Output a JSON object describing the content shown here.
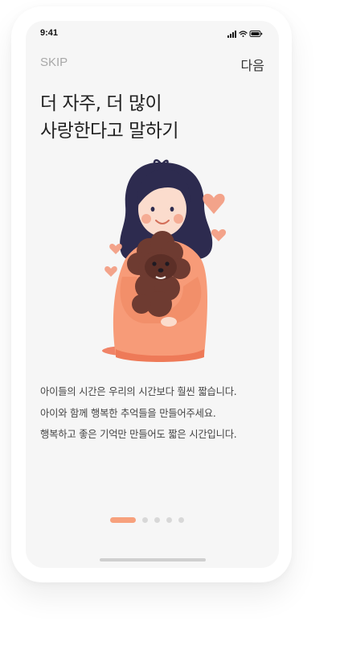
{
  "status_bar": {
    "time": "9:41",
    "icons": [
      "signal-icon",
      "wifi-icon",
      "battery-icon"
    ]
  },
  "nav": {
    "skip_label": "SKIP",
    "next_label": "다음"
  },
  "onboarding": {
    "title_lines": [
      "더 자주, 더 많이",
      "사랑한다고 말하기"
    ],
    "illustration": "girl-hugging-poodle-illustration",
    "description_lines": [
      "아이들의 시간은 우리의 시간보다 훨씬 짧습니다.",
      "아이와 함께 행복한 추억들을 만들어주세요.",
      "행복하고 좋은 기억만 만들어도 짧은 시간입니다."
    ],
    "pager": {
      "total": 5,
      "current": 1
    }
  },
  "colors": {
    "accent": "#f7a17d",
    "background": "#f6f6f6",
    "text": "#222222",
    "muted": "#a8a8a8"
  }
}
